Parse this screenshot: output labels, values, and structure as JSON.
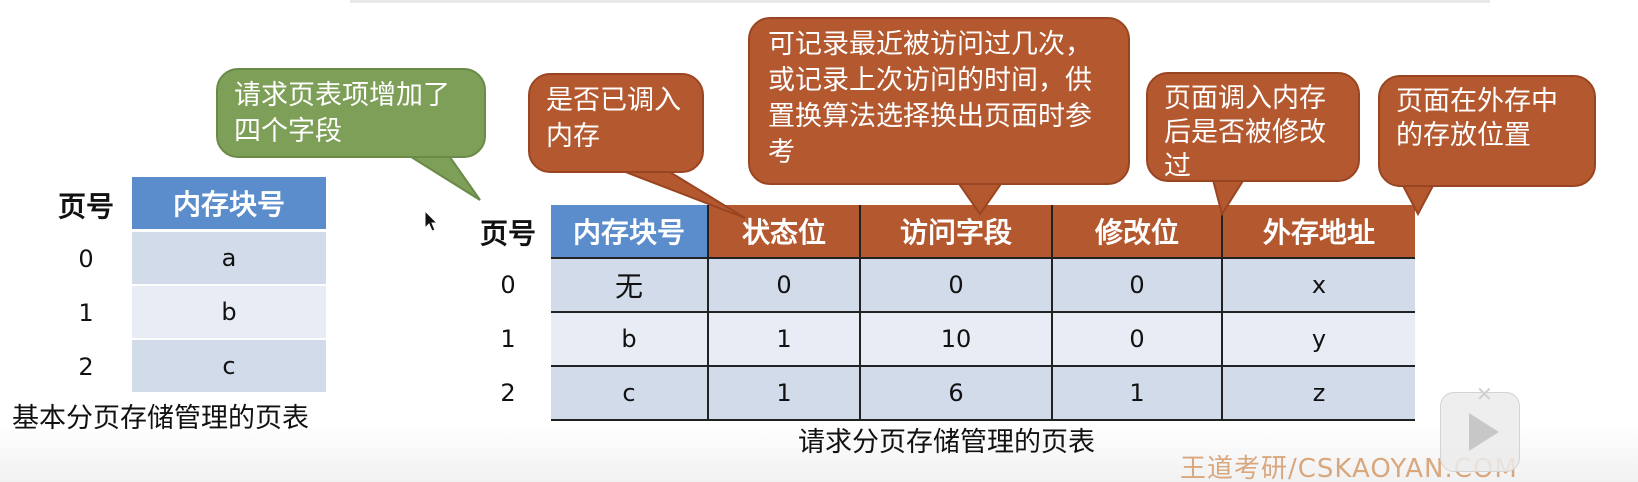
{
  "callouts": {
    "fields_added": "请求页表项增加了四个字段",
    "state_bit": "是否已调入内存",
    "access_field": "可记录最近被访问过几次，或记录上次访问的时间，供置换算法选择换出页面时参考",
    "modify_bit": "页面调入内存后是否被修改过",
    "external_address": "页面在外存中的存放位置"
  },
  "basic_table": {
    "caption": "基本分页存储管理的页表",
    "headers": {
      "page_no": "页号",
      "frame_no": "内存块号"
    },
    "rows": [
      {
        "page_no": "0",
        "frame_no": "a"
      },
      {
        "page_no": "1",
        "frame_no": "b"
      },
      {
        "page_no": "2",
        "frame_no": "c"
      }
    ]
  },
  "request_table": {
    "caption": "请求分页存储管理的页表",
    "headers": {
      "page_no": "页号",
      "frame_no": "内存块号",
      "state_bit": "状态位",
      "access_field": "访问字段",
      "modify_bit": "修改位",
      "external_address": "外存地址"
    },
    "rows": [
      {
        "page_no": "0",
        "frame_no": "无",
        "state_bit": "0",
        "access_field": "0",
        "modify_bit": "0",
        "external_address": "x"
      },
      {
        "page_no": "1",
        "frame_no": "b",
        "state_bit": "1",
        "access_field": "10",
        "modify_bit": "0",
        "external_address": "y"
      },
      {
        "page_no": "2",
        "frame_no": "c",
        "state_bit": "1",
        "access_field": "6",
        "modify_bit": "1",
        "external_address": "z"
      }
    ]
  },
  "watermark": "王道考研/CSKAOYAN.COM",
  "colors": {
    "blue_header": "#5b8ccb",
    "orange_header": "#b4582f",
    "green_callout": "#7e9f58",
    "row_dark": "#d2dbea",
    "row_light": "#e8ecf4"
  },
  "icons": {
    "cursor": "arrow-cursor-icon",
    "play": "play-icon"
  }
}
